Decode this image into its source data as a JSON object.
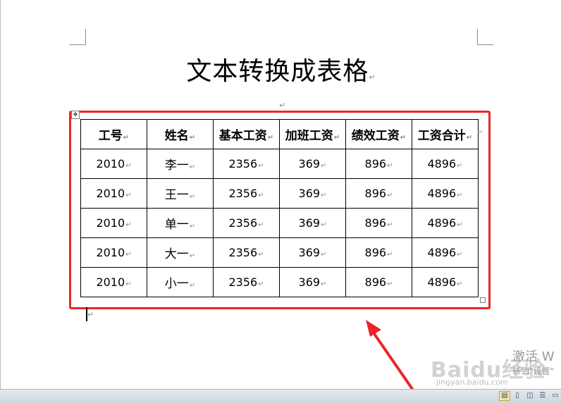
{
  "document": {
    "title": "文本转换成表格",
    "para_mark": "↵"
  },
  "table": {
    "headers": [
      "工号",
      "姓名",
      "基本工资",
      "加班工资",
      "绩效工资",
      "工资合计"
    ],
    "rows": [
      [
        "2010",
        "李一",
        "2356",
        "369",
        "896",
        "4896"
      ],
      [
        "2010",
        "王一",
        "2356",
        "369",
        "896",
        "4896"
      ],
      [
        "2010",
        "单一",
        "2356",
        "369",
        "896",
        "4896"
      ],
      [
        "2010",
        "大一",
        "2356",
        "369",
        "896",
        "4896"
      ],
      [
        "2010",
        "小一",
        "2356",
        "369",
        "896",
        "4896"
      ]
    ]
  },
  "watermark": {
    "logo": "Baidu经验",
    "url": "jingyan.baidu.com",
    "activate_line1": "激活 W",
    "activate_line2": "转到\"设置\""
  },
  "statusbar": {
    "view_buttons": [
      "print-layout-view",
      "full-screen-reading-view",
      "web-layout-view",
      "outline-view",
      "draft-view"
    ]
  },
  "colors": {
    "highlight": "#e8262a",
    "arrow": "#e8262a"
  }
}
